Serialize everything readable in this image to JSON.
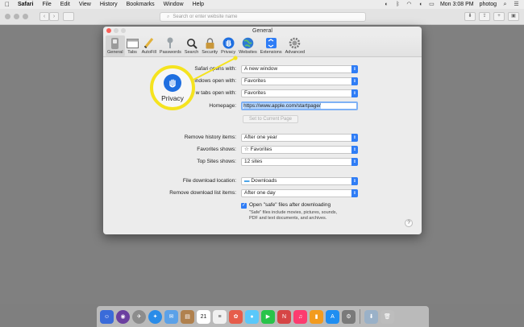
{
  "menubar": {
    "apple_icon": "apple-icon",
    "app_name": "Safari",
    "items": [
      "File",
      "Edit",
      "View",
      "History",
      "Bookmarks",
      "Window",
      "Help"
    ],
    "clock": "Mon 3:08 PM",
    "user": "photog"
  },
  "browser": {
    "url_placeholder": "Search or enter website name"
  },
  "prefs": {
    "title": "General",
    "tabs": [
      {
        "label": "General",
        "icon": "switch-icon"
      },
      {
        "label": "Tabs",
        "icon": "tabs-icon"
      },
      {
        "label": "AutoFill",
        "icon": "pencil-icon"
      },
      {
        "label": "Passwords",
        "icon": "key-icon"
      },
      {
        "label": "Search",
        "icon": "magnifier-icon"
      },
      {
        "label": "Security",
        "icon": "lock-icon"
      },
      {
        "label": "Privacy",
        "icon": "hand-icon"
      },
      {
        "label": "Websites",
        "icon": "globe-icon"
      },
      {
        "label": "Extensions",
        "icon": "puzzle-icon"
      },
      {
        "label": "Advanced",
        "icon": "gear-icon"
      }
    ],
    "rows": {
      "safari_opens_label": "Safari opens with:",
      "safari_opens_value": "A new window",
      "windows_open_label": "New windows open with:",
      "windows_open_value": "Favorites",
      "tabs_open_label": "New tabs open with:",
      "tabs_open_value": "Favorites",
      "homepage_label": "Homepage:",
      "homepage_value": "https://www.apple.com/startpage/",
      "set_current_label": "Set to Current Page",
      "remove_history_label": "Remove history items:",
      "remove_history_value": "After one year",
      "favorites_shows_label": "Favorites shows:",
      "favorites_shows_value": "Favorites",
      "top_sites_label": "Top Sites shows:",
      "top_sites_value": "12 sites",
      "download_location_label": "File download location:",
      "download_location_value": "Downloads",
      "remove_download_label": "Remove download list items:",
      "remove_download_value": "After one day",
      "open_safe_label": "Open \"safe\" files after downloading",
      "safe_note": "\"Safe\" files include movies, pictures, sounds, PDF and text documents, and archives.",
      "help": "?"
    },
    "label_visible": {
      "safari_opens": "Safari opens with:",
      "windows_open": "indows open with:",
      "tabs_open": "w tabs open with:"
    }
  },
  "callout": {
    "label": "Privacy",
    "color": "#f5e31f"
  },
  "dock": {
    "calendar_day": "21"
  }
}
